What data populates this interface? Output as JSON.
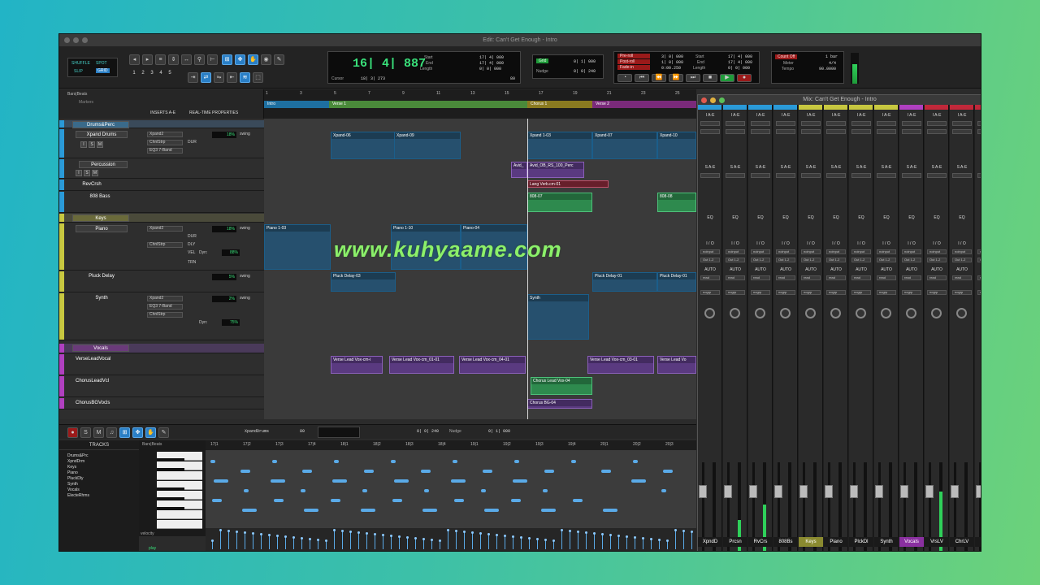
{
  "window": {
    "edit_title": "Edit: Can't Get Enough - Intro",
    "mix_title": "Mix: Can't Get Enough - Intro"
  },
  "toolbar": {
    "modes": [
      "SHUFFLE",
      "SPOT",
      "SLIP",
      "GRID"
    ],
    "zoom_presets": [
      "1",
      "2",
      "3",
      "4",
      "5"
    ],
    "main_counter": "16| 4| 887",
    "start_label": "Start",
    "start_value": "17| 4| 000",
    "end_label": "End",
    "end_value": "17| 4| 000",
    "length_label": "Length",
    "length_value": "0| 0| 000",
    "cursor_label": "Cursor",
    "cursor_value": "18| 3| 273",
    "grid_label": "Grid",
    "grid_value": "0| 1| 000",
    "nudge_label": "Nudge",
    "nudge_value": "0| 0| 240",
    "transport_value_1": "3| 0| 000",
    "transport_value_2": "1| 0| 000",
    "transport_value_3": "0:00.250",
    "transport_value_4": "17| 4| 000",
    "transport_value_5": "17| 4| 000",
    "transport_value_6": "0| 0| 000",
    "pre_roll": "Pre-roll",
    "post_roll": "Post-roll",
    "fade_in": "Fade-in",
    "count_off": "Count Off",
    "meter_label": "Meter",
    "meter_value": "4/4",
    "tempo_label": "Tempo",
    "tempo_value": "90.0000",
    "count_bars": "1 bar",
    "ctrl_value": "80"
  },
  "timeline": {
    "rulers": [
      "Bars|Beats",
      "Markers"
    ],
    "headers": [
      "INSERTS A-E",
      "REAL-TIME PROPERTIES"
    ],
    "markers": [
      {
        "label": "Intro",
        "color": "#1e88c8"
      },
      {
        "label": "Verse 1",
        "color": "#4a9a3a"
      },
      {
        "label": "Chorus 1",
        "color": "#c0a030"
      },
      {
        "label": "Verse 2",
        "color": "#8a2a8a"
      }
    ],
    "bar_numbers": [
      "1",
      "3",
      "5",
      "7",
      "9",
      "11",
      "13",
      "15",
      "17",
      "19",
      "21",
      "23",
      "25"
    ]
  },
  "tracks": [
    {
      "name": "Drums&Perc",
      "color": "#2a9ad8"
    },
    {
      "name": "Xpand Drums",
      "color": "#2a9ad8",
      "insert": "Xpand2",
      "insert2": "ChnlStrp",
      "insert3": "EQ3 7-Band",
      "pct": "18%",
      "swing": "swing"
    },
    {
      "name": "Percussion",
      "color": "#2a9ad8"
    },
    {
      "name": "RevCrsh",
      "color": "#2a9ad8"
    },
    {
      "name": "808 Bass",
      "color": "#2a9ad8"
    },
    {
      "name": "Keys",
      "color": "#c8c840"
    },
    {
      "name": "Piano",
      "color": "#c8c840",
      "insert": "Xpand2",
      "insert2": "ChnlStrp",
      "pct": "18%",
      "swing": "swing",
      "dyn": "88%"
    },
    {
      "name": "Pluck Delay",
      "color": "#c8c840",
      "pct": "5%",
      "swing": "swing"
    },
    {
      "name": "Synth",
      "color": "#c8c840",
      "insert": "Xpand2",
      "insert2": "EQ3 7-Band",
      "insert3": "ChnlStrp",
      "pct": "2%",
      "swing": "swing",
      "dyn": "75%"
    },
    {
      "name": "Vocals",
      "color": "#b040c0"
    },
    {
      "name": "VerseLeadVocal",
      "color": "#b040c0"
    },
    {
      "name": "ChorusLeadVcl",
      "color": "#b040c0"
    },
    {
      "name": "ChorusBGVocls",
      "color": "#b040c0"
    }
  ],
  "track_labels": {
    "dur": "DUR",
    "dly": "DLY",
    "trn": "TRN",
    "vel": "VEL",
    "dyn": "Dyn:",
    "clips": "clips",
    "wave": "wave",
    "none": "none",
    "solo": "S",
    "mute": "M",
    "input": "I",
    "record": "R"
  },
  "clips": [
    {
      "name": "Xpand-06"
    },
    {
      "name": "Xpand-09"
    },
    {
      "name": "Xpand 1-03"
    },
    {
      "name": "Xpand-07"
    },
    {
      "name": "Xpand-10"
    },
    {
      "name": "Avid_OB_RS_100_Perc"
    },
    {
      "name": "Avid_"
    },
    {
      "name": "Lang Verb.cm-01"
    },
    {
      "name": "808-07"
    },
    {
      "name": "808-08"
    },
    {
      "name": "Piano 1-03"
    },
    {
      "name": "Piano 1-10"
    },
    {
      "name": "Piano-04"
    },
    {
      "name": "Pluck Delay-03"
    },
    {
      "name": "Pluck Delay-01"
    },
    {
      "name": "Pluck Delay-01"
    },
    {
      "name": "Synth"
    },
    {
      "name": "Verse Lead Vox-cm-i"
    },
    {
      "name": "Verse Lead Vox-cm_01-01"
    },
    {
      "name": "Verse Lead Vox-cm_04-01"
    },
    {
      "name": "Verse Lead Vox-cm_03-01"
    },
    {
      "name": "Verse Lead Vo"
    },
    {
      "name": "Chorus Lead Vox-04"
    },
    {
      "name": "Chorus BG-04"
    }
  ],
  "clip_gain": "0 dB",
  "watermark": "www.kuhyaame.com",
  "mixer": {
    "labels": {
      "inserts": "I A-E",
      "sends": "S A-E",
      "eq": "EQ",
      "io": "I / O",
      "no_input": "noinput",
      "out": "Out 1-2",
      "auto": "AUTO",
      "read": "read",
      "no_group": "nogrp"
    },
    "strips": [
      {
        "name": "XpndD",
        "color": "#2a9ad8",
        "vol": "+1.2",
        "level": 0.12
      },
      {
        "name": "Prcsn",
        "color": "#2a9ad8",
        "vol": "-19.9",
        "level": 0.45
      },
      {
        "name": "RvCrs",
        "color": "#2a9ad8",
        "vol": "-11.9",
        "level": 0.6
      },
      {
        "name": "808Bs",
        "color": "#2a9ad8",
        "vol": "-14.0",
        "level": 0.0
      },
      {
        "name": "Keys",
        "color": "#c8c840",
        "vol": "",
        "level": 0.0
      },
      {
        "name": "Piano",
        "color": "#c8c840",
        "vol": "-7.2",
        "level": 0.08
      },
      {
        "name": "PlckDl",
        "color": "#c8c840",
        "vol": "-5.7",
        "level": 0.0
      },
      {
        "name": "Synth",
        "color": "#c8c840",
        "vol": "-12.1",
        "level": 0.0
      },
      {
        "name": "Vocals",
        "color": "#b040c0",
        "vol": "",
        "level": 0.0
      },
      {
        "name": "VrsLV",
        "color": "#c0283a",
        "vol": "-4.6",
        "level": 0.72
      },
      {
        "name": "ChrLV",
        "color": "#c0283a",
        "vol": "-3.6",
        "level": 0.0
      },
      {
        "name": "Ch",
        "color": "#c0283a",
        "vol": "",
        "level": 0.0
      }
    ]
  },
  "midi_editor": {
    "tracks_header": "TRACKS",
    "tracks": [
      "Drums&Prc",
      "XpndDrm",
      "Keys",
      "Piano",
      "PluckDly",
      "Synth",
      "Vocals",
      "ElecteRhms"
    ],
    "ruler_label": "Bars|Beats",
    "ruler_ticks": [
      "17|1",
      "17|2",
      "17|3",
      "17|4",
      "18|1",
      "18|2",
      "18|3",
      "18|4",
      "19|1",
      "19|2",
      "19|3",
      "19|4",
      "20|1",
      "20|2",
      "20|3"
    ],
    "instrument": "XpandDrums",
    "velocity_label": "velocity",
    "play_label": "play",
    "grid_value": "0| 0| 240",
    "nudge_value": "0| 1| 000",
    "ctrl_value": "80"
  }
}
